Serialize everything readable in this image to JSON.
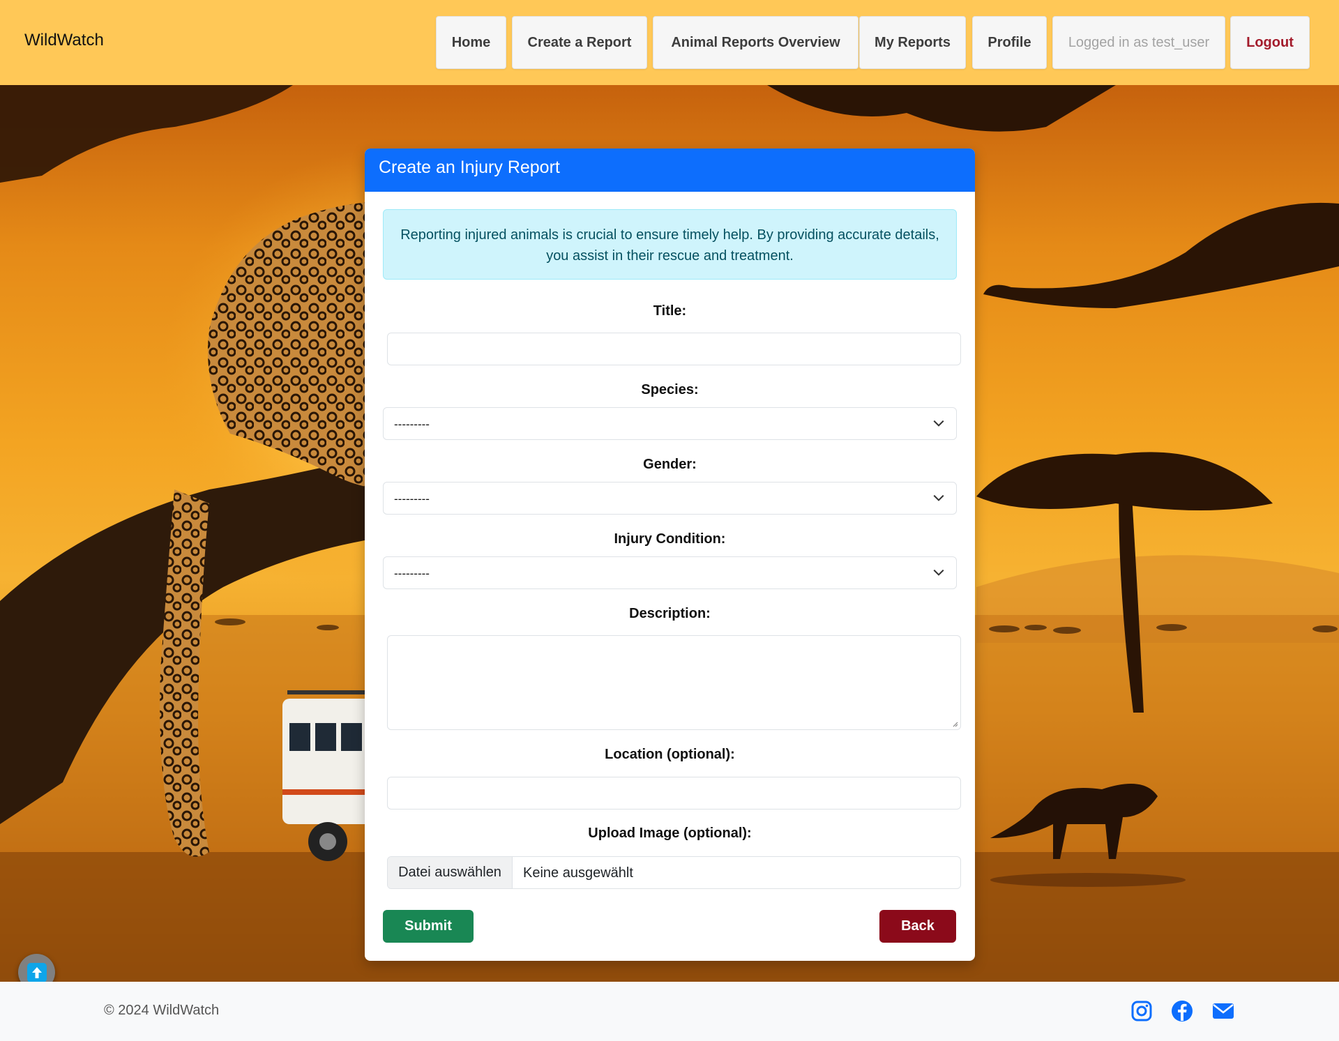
{
  "navbar": {
    "brand": "WildWatch",
    "items": [
      {
        "label": "Home"
      },
      {
        "label": "Create a Report"
      },
      {
        "label": "Animal Reports Overview"
      },
      {
        "label": "My Reports"
      },
      {
        "label": "Profile"
      },
      {
        "label": "Logged in as test_user"
      },
      {
        "label": "Logout"
      }
    ]
  },
  "form": {
    "title": "Create an Injury Report",
    "info": "Reporting injured animals is crucial to ensure timely help. By providing accurate details, you assist in their rescue and treatment.",
    "fields": {
      "title": {
        "label": "Title:",
        "value": ""
      },
      "species": {
        "label": "Species:",
        "value": "---------"
      },
      "gender": {
        "label": "Gender:",
        "value": "---------"
      },
      "injury_condition": {
        "label": "Injury Condition:",
        "value": "---------"
      },
      "description": {
        "label": "Description:",
        "value": ""
      },
      "location": {
        "label": "Location (optional):",
        "value": ""
      },
      "image": {
        "label": "Upload Image (optional):",
        "button": "Datei auswählen",
        "status": "Keine ausgewählt"
      }
    },
    "submit_label": "Submit",
    "back_label": "Back"
  },
  "footer": {
    "copyright": "© 2024 WildWatch",
    "social_icons": [
      "instagram-icon",
      "facebook-icon",
      "envelope-icon"
    ]
  },
  "colors": {
    "navbar": "#ffc857",
    "card_header": "#0d6efd",
    "submit": "#198754",
    "back": "#8b0a1a",
    "social": "#0d6efd"
  }
}
